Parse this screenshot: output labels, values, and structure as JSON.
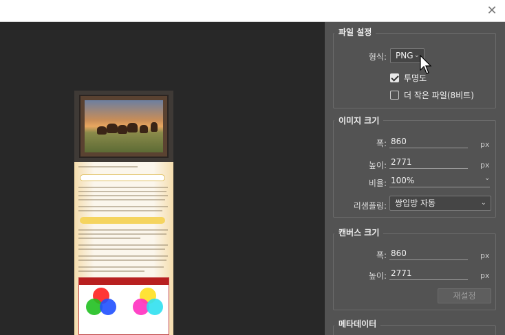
{
  "window": {
    "close_label": "✕"
  },
  "file_settings": {
    "title": "파일 설정",
    "format_label": "형식:",
    "format_value": "PNG",
    "transparency_label": "투명도",
    "transparency_checked": true,
    "smaller_file_label": "더 작은 파일(8비트)",
    "smaller_file_checked": false
  },
  "image_size": {
    "title": "이미지 크기",
    "width_label": "폭:",
    "width_value": "860",
    "width_unit": "px",
    "height_label": "높이:",
    "height_value": "2771",
    "height_unit": "px",
    "scale_label": "비율:",
    "scale_value": "100%",
    "resample_label": "리샘플링:",
    "resample_value": "쌍입방 자동"
  },
  "canvas_size": {
    "title": "캔버스 크기",
    "width_label": "폭:",
    "width_value": "860",
    "width_unit": "px",
    "height_label": "높이:",
    "height_value": "2771",
    "height_unit": "px",
    "reset_label": "재설정"
  },
  "metadata": {
    "title": "메타데이터"
  },
  "colors": {
    "panel_bg": "#535353",
    "preview_bg": "#282828",
    "field_bg": "#454545"
  }
}
